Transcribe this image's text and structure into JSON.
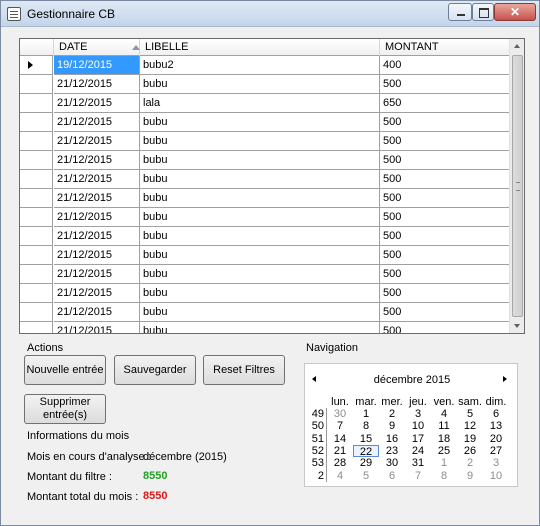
{
  "window": {
    "title": "Gestionnaire CB"
  },
  "grid": {
    "columns": [
      "DATE",
      "LIBELLE",
      "MONTANT"
    ],
    "rows": [
      {
        "date": "19/12/2015",
        "libelle": "bubu2",
        "montant": "400"
      },
      {
        "date": "21/12/2015",
        "libelle": "bubu",
        "montant": "500"
      },
      {
        "date": "21/12/2015",
        "libelle": "lala",
        "montant": "650"
      },
      {
        "date": "21/12/2015",
        "libelle": "bubu",
        "montant": "500"
      },
      {
        "date": "21/12/2015",
        "libelle": "bubu",
        "montant": "500"
      },
      {
        "date": "21/12/2015",
        "libelle": "bubu",
        "montant": "500"
      },
      {
        "date": "21/12/2015",
        "libelle": "bubu",
        "montant": "500"
      },
      {
        "date": "21/12/2015",
        "libelle": "bubu",
        "montant": "500"
      },
      {
        "date": "21/12/2015",
        "libelle": "bubu",
        "montant": "500"
      },
      {
        "date": "21/12/2015",
        "libelle": "bubu",
        "montant": "500"
      },
      {
        "date": "21/12/2015",
        "libelle": "bubu",
        "montant": "500"
      },
      {
        "date": "21/12/2015",
        "libelle": "bubu",
        "montant": "500"
      },
      {
        "date": "21/12/2015",
        "libelle": "bubu",
        "montant": "500"
      },
      {
        "date": "21/12/2015",
        "libelle": "bubu",
        "montant": "500"
      },
      {
        "date": "21/12/2015",
        "libelle": "bubu",
        "montant": "500"
      }
    ]
  },
  "actions": {
    "group_label": "Actions",
    "new_entry": "Nouvelle entrée",
    "save": "Sauvegarder",
    "reset_filters": "Reset Filtres",
    "delete_line1": "Supprimer",
    "delete_line2": "entrée(s)"
  },
  "info": {
    "group_label": "Informations du mois",
    "month_label": "Mois en cours d'analyse :",
    "month_value": "décembre (2015)",
    "filter_label": "Montant du filtre :",
    "filter_value": "8550",
    "total_label": "Montant total du mois :",
    "total_value": "8550",
    "filter_color": "#22a022",
    "total_color": "#e01818"
  },
  "navigation": {
    "group_label": "Navigation",
    "month_title": "décembre 2015",
    "weekdays": [
      "lun.",
      "mar.",
      "mer.",
      "jeu.",
      "ven.",
      "sam.",
      "dim."
    ],
    "weeks": [
      {
        "num": "49",
        "days": [
          {
            "d": "30",
            "dim": true
          },
          {
            "d": "1"
          },
          {
            "d": "2"
          },
          {
            "d": "3"
          },
          {
            "d": "4"
          },
          {
            "d": "5"
          },
          {
            "d": "6"
          }
        ]
      },
      {
        "num": "50",
        "days": [
          {
            "d": "7"
          },
          {
            "d": "8"
          },
          {
            "d": "9"
          },
          {
            "d": "10"
          },
          {
            "d": "11"
          },
          {
            "d": "12"
          },
          {
            "d": "13"
          }
        ]
      },
      {
        "num": "51",
        "days": [
          {
            "d": "14"
          },
          {
            "d": "15"
          },
          {
            "d": "16"
          },
          {
            "d": "17"
          },
          {
            "d": "18"
          },
          {
            "d": "19"
          },
          {
            "d": "20"
          }
        ]
      },
      {
        "num": "52",
        "days": [
          {
            "d": "21"
          },
          {
            "d": "22",
            "today": true
          },
          {
            "d": "23"
          },
          {
            "d": "24"
          },
          {
            "d": "25"
          },
          {
            "d": "26"
          },
          {
            "d": "27"
          }
        ]
      },
      {
        "num": "53",
        "days": [
          {
            "d": "28"
          },
          {
            "d": "29"
          },
          {
            "d": "30"
          },
          {
            "d": "31"
          },
          {
            "d": "1",
            "dim": true
          },
          {
            "d": "2",
            "dim": true
          },
          {
            "d": "3",
            "dim": true
          }
        ]
      },
      {
        "num": "2",
        "days": [
          {
            "d": "4",
            "dim": true
          },
          {
            "d": "5",
            "dim": true
          },
          {
            "d": "6",
            "dim": true
          },
          {
            "d": "7",
            "dim": true
          },
          {
            "d": "8",
            "dim": true
          },
          {
            "d": "9",
            "dim": true
          },
          {
            "d": "10",
            "dim": true
          }
        ]
      }
    ]
  }
}
